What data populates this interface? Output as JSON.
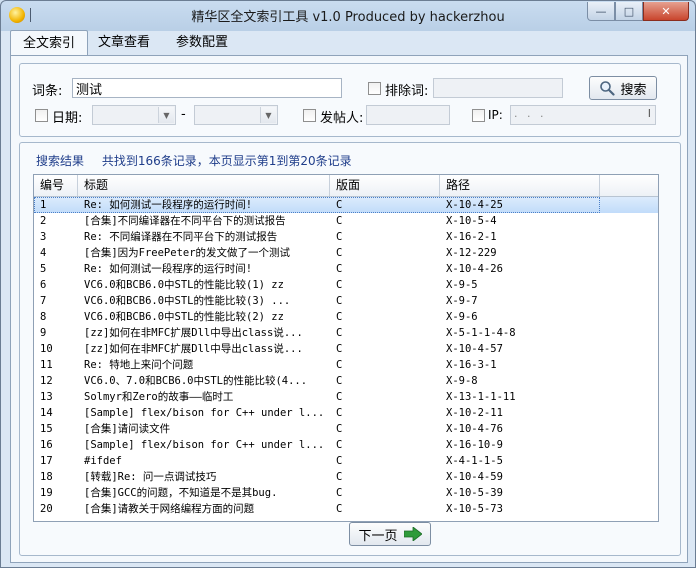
{
  "window": {
    "title": "精华区全文索引工具 v1.0 Produced by hackerzhou",
    "min_glyph": "—",
    "max_glyph": "□",
    "close_glyph": "✕"
  },
  "tabs": [
    "全文索引",
    "文章查看",
    "参数配置"
  ],
  "search": {
    "keyword_label": "词条:",
    "keyword_value": "测试",
    "exclude_label": "排除词:",
    "exclude_value": "",
    "search_button": "搜索",
    "date_label": "日期:",
    "date_sep": "-",
    "poster_label": "发帖人:",
    "ip_label": "IP:",
    "ip_value": "  .   .   .",
    "ip_cursor": "I"
  },
  "results": {
    "label": "搜索结果",
    "summary": "共找到166条记录，本页显示第1到第20条记录",
    "columns": [
      "编号",
      "标题",
      "版面",
      "路径"
    ],
    "rows": [
      {
        "id": "1",
        "title": "Re: 如何测试一段程序的运行时间!",
        "board": "C",
        "path": "X-10-4-25"
      },
      {
        "id": "2",
        "title": "[合集]不同编译器在不同平台下的测试报告",
        "board": "C",
        "path": "X-10-5-4"
      },
      {
        "id": "3",
        "title": "Re: 不同编译器在不同平台下的测试报告",
        "board": "C",
        "path": "X-16-2-1"
      },
      {
        "id": "4",
        "title": "[合集]因为FreePeter的发文做了一个测试",
        "board": "C",
        "path": "X-12-229"
      },
      {
        "id": "5",
        "title": "Re: 如何测试一段程序的运行时间!",
        "board": "C",
        "path": "X-10-4-26"
      },
      {
        "id": "6",
        "title": "VC6.0和BCB6.0中STL的性能比较(1) zz",
        "board": "C",
        "path": "X-9-5"
      },
      {
        "id": "7",
        "title": "VC6.0和BCB6.0中STL的性能比较(3)    ...",
        "board": "C",
        "path": "X-9-7"
      },
      {
        "id": "8",
        "title": "VC6.0和BCB6.0中STL的性能比较(2) zz",
        "board": "C",
        "path": "X-9-6"
      },
      {
        "id": "9",
        "title": "[zz]如何在非MFC扩展Dll中导出class说...",
        "board": "C",
        "path": "X-5-1-1-4-8"
      },
      {
        "id": "10",
        "title": "[zz]如何在非MFC扩展Dll中导出class说...",
        "board": "C",
        "path": "X-10-4-57"
      },
      {
        "id": "11",
        "title": "Re: 特地上来问个问题",
        "board": "C",
        "path": "X-16-3-1"
      },
      {
        "id": "12",
        "title": "VC6.0、7.0和BCB6.0中STL的性能比较(4...",
        "board": "C",
        "path": "X-9-8"
      },
      {
        "id": "13",
        "title": "Solmyr和Zero的故事——临时工",
        "board": "C",
        "path": "X-13-1-1-11"
      },
      {
        "id": "14",
        "title": "[Sample] flex/bison for C++ under l...",
        "board": "C",
        "path": "X-10-2-11"
      },
      {
        "id": "15",
        "title": "[合集]请问读文件",
        "board": "C",
        "path": "X-10-4-76"
      },
      {
        "id": "16",
        "title": "[Sample] flex/bison for C++ under l...",
        "board": "C",
        "path": "X-16-10-9"
      },
      {
        "id": "17",
        "title": "#ifdef",
        "board": "C",
        "path": "X-4-1-1-5"
      },
      {
        "id": "18",
        "title": "[转载]Re: 问一点调试技巧",
        "board": "C",
        "path": "X-10-4-59"
      },
      {
        "id": "19",
        "title": "[合集]GCC的问题，不知道是不是其bug.",
        "board": "C",
        "path": "X-10-5-39"
      },
      {
        "id": "20",
        "title": "[合集]请教关于网络编程方面的问题",
        "board": "C",
        "path": "X-10-5-73"
      }
    ]
  },
  "next_button": "下一页",
  "colors": {
    "accent_text": "#1f3d8a",
    "selection": "#c1dcfa",
    "next_arrow": "#2f9b3a"
  }
}
